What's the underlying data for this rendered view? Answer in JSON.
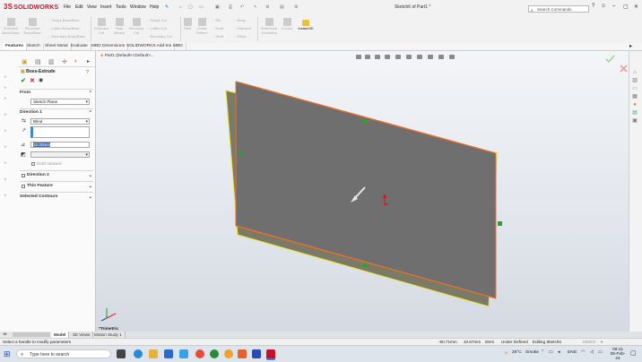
{
  "app": {
    "logo_prefix": "3S",
    "logo_text": "SOLIDWORKS",
    "document_title": "Sketch6 of Part1 *",
    "menus": [
      "File",
      "Edit",
      "View",
      "Insert",
      "Tools",
      "Window",
      "Help"
    ],
    "search_placeholder": "Search Commands"
  },
  "commands": {
    "boss_extrude": "Extruded Boss/Base",
    "revolved_boss": "Revolved Boss/Base",
    "swept_boss": "Swept Boss/Base",
    "lofted_boss": "Lofted Boss/Base",
    "boundary_boss": "Boundary Boss/Base",
    "extruded_cut": "Extruded Cut",
    "hole_wizard": "Hole Wizard",
    "revolved_cut": "Revolved Cut",
    "swept_cut": "Swept Cut",
    "lofted_cut": "Lofted Cut",
    "boundary_cut": "Boundary Cut",
    "fillet": "Fillet",
    "linear_pattern": "Linear Pattern",
    "rib": "Rib",
    "draft": "Draft",
    "shell": "Shell",
    "wrap": "Wrap",
    "intersect": "Intersect",
    "mirror": "Mirror",
    "reference_geometry": "Reference Geometry",
    "curves": "Curves",
    "instant3d": "Instant3D"
  },
  "tabs": [
    "Features",
    "Sketch",
    "Sheet Metal",
    "Evaluate",
    "MBD Dimensions",
    "SOLIDWORKS Add-Ins",
    "MBD"
  ],
  "feature": {
    "title": "Boss-Extrude",
    "from_label": "From",
    "from_value": "Sketch Plane",
    "direction1_label": "Direction 1",
    "end_condition": "Blind",
    "depth": "10.00mm",
    "draft_outward": "Draft outward",
    "direction2_label": "Direction 2",
    "thin_feature_label": "Thin Feature",
    "selected_contours_label": "Selected Contours"
  },
  "tree": {
    "part_label": "Part1 (Default<<Default>..."
  },
  "view": {
    "orientation_label": "*Trimetric"
  },
  "bottom_tabs": [
    "Model",
    "3D Views",
    "Motion Study 1"
  ],
  "status": {
    "hint": "Select a handle to modify parameters",
    "x": "-50.71mm",
    "y": "10.67mm",
    "z": "0mm",
    "state": "Under Defined",
    "editing": "Editing Sketch6",
    "units": "MMGS"
  },
  "taskbar": {
    "search_placeholder": "Type here to search",
    "temperature": "26°C",
    "weather": "Smoke",
    "language": "ENG",
    "time": "09:41",
    "date": "08-Feb-24"
  },
  "colors": {
    "accent_red": "#c8102e",
    "edge_orange": "#e8702a",
    "edge_yellow": "#e8e23a",
    "face_gray": "#6f6f6f",
    "handle_green": "#16b01a",
    "confirm_green": "#1a9c2a"
  }
}
